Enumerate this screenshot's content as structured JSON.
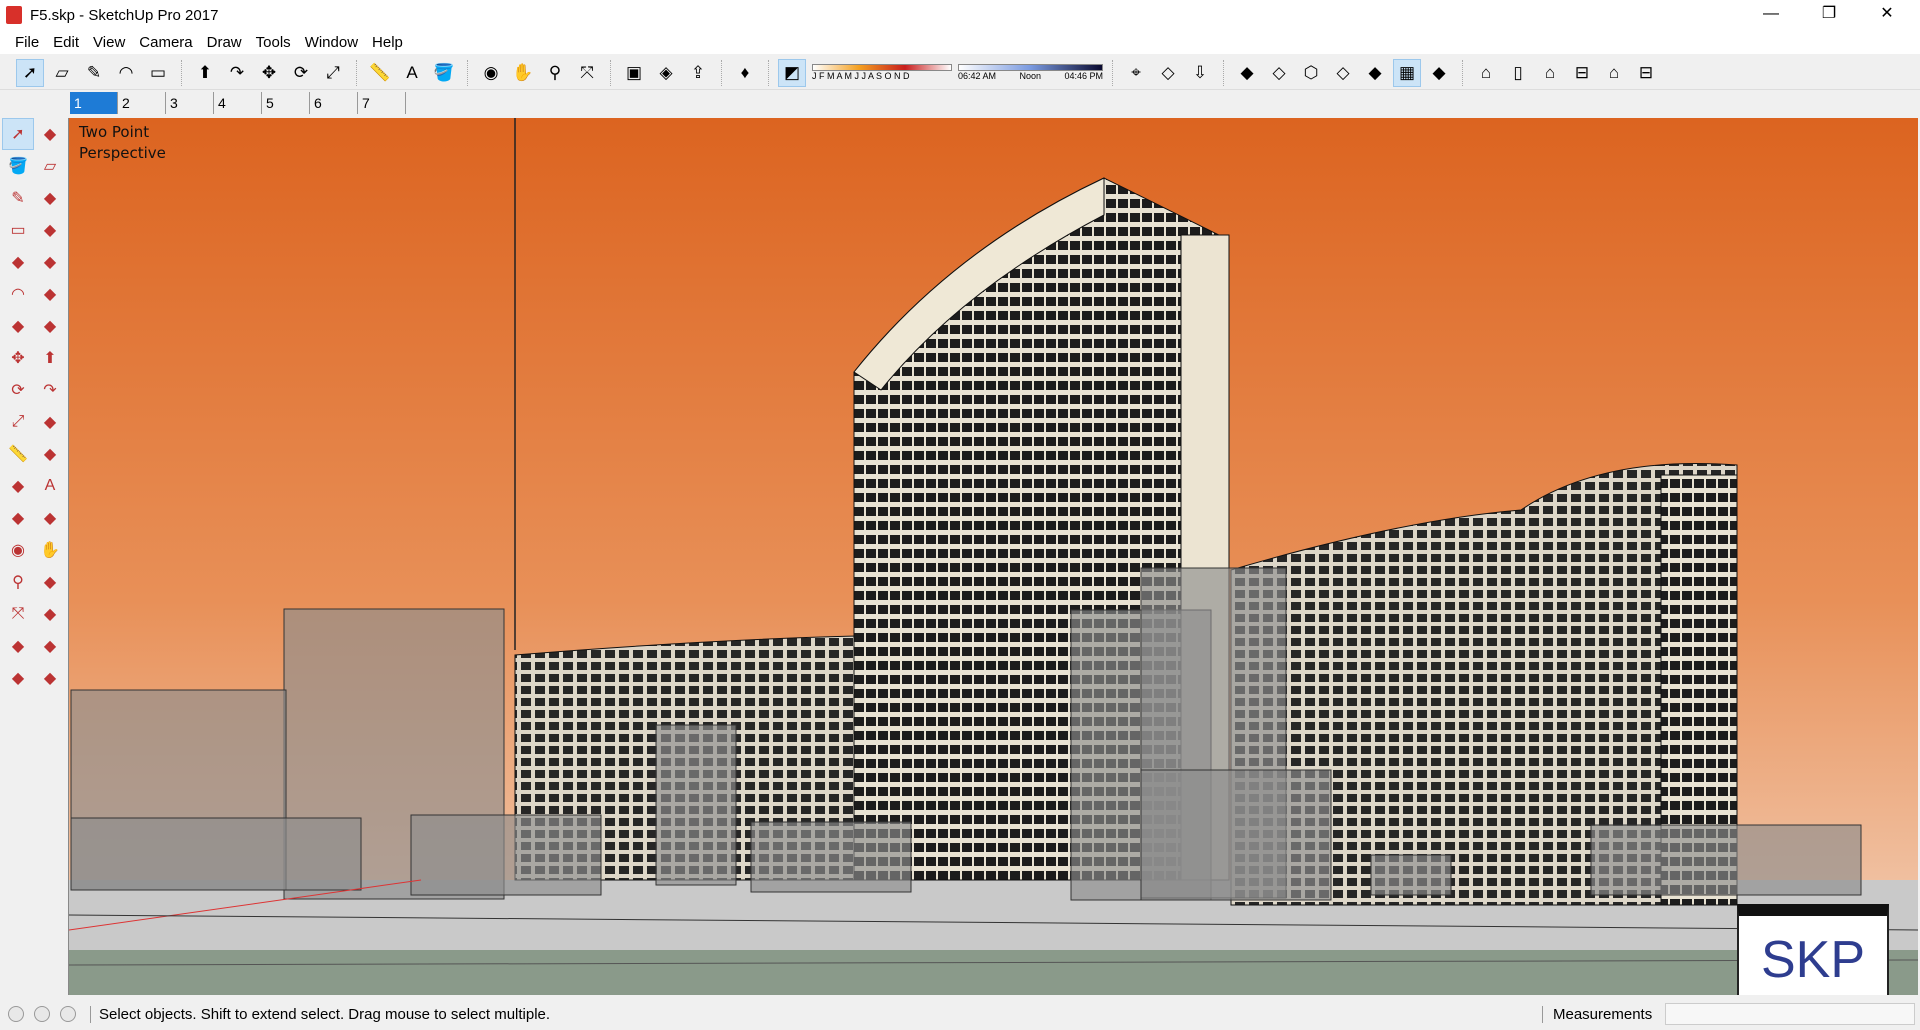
{
  "window": {
    "title": "F5.skp - SketchUp Pro 2017",
    "minimize": "—",
    "restore": "❐",
    "close": "✕"
  },
  "menu": [
    "File",
    "Edit",
    "View",
    "Camera",
    "Draw",
    "Tools",
    "Window",
    "Help"
  ],
  "toolbar": {
    "icons_a": [
      "select-icon",
      "eraser-icon",
      "pencil-icon",
      "arc-icon",
      "rectangle-icon"
    ],
    "icons_b": [
      "push-pull-icon",
      "follow-me-icon",
      "move-icon",
      "rotate-icon",
      "scale-icon"
    ],
    "icons_c": [
      "tape-measure-icon",
      "text-icon",
      "paint-bucket-icon"
    ],
    "icons_d": [
      "orbit-icon",
      "pan-icon",
      "zoom-icon",
      "zoom-extents-icon"
    ],
    "icons_e": [
      "warehouse-icon",
      "extension-icon",
      "share-model-icon"
    ],
    "icons_f": [
      "ruby-icon"
    ],
    "shadow": {
      "months": "J F M A M J J A S O N D",
      "time_start": "06:42 AM",
      "time_mid": "Noon",
      "time_end": "04:46 PM"
    },
    "icons_g": [
      "geo-location-icon",
      "terrain-icon",
      "add-location-icon"
    ],
    "icons_h": [
      "xray-icon",
      "back-edges-icon",
      "wireframe-icon",
      "hidden-line-icon",
      "shaded-icon",
      "shaded-textures-icon",
      "monochrome-icon"
    ],
    "icons_i": [
      "iso-view-icon",
      "top-view-icon",
      "front-view-icon",
      "right-view-icon",
      "back-view-icon",
      "left-view-icon"
    ]
  },
  "tabs": [
    "1",
    "2",
    "3",
    "4",
    "5",
    "6",
    "7"
  ],
  "left_tools": [
    "select-icon",
    "component-icon",
    "paint-bucket-icon",
    "eraser-icon",
    "pencil-icon",
    "freehand-icon",
    "rectangle-icon",
    "rotated-rectangle-icon",
    "circle-icon",
    "polygon-icon",
    "arc-icon",
    "pie-icon",
    "three-point-arc-icon",
    "two-point-arc-icon",
    "move-icon",
    "push-pull-icon",
    "rotate-icon",
    "follow-me-icon",
    "scale-icon",
    "offset-icon",
    "tape-measure-icon",
    "dimension-icon",
    "protractor-icon",
    "text-icon",
    "axes-icon",
    "3d-text-icon",
    "orbit-icon",
    "pan-icon",
    "zoom-icon",
    "zoom-window-icon",
    "zoom-extents-icon",
    "previous-view-icon",
    "position-camera-icon",
    "look-around-icon",
    "walk-icon",
    "section-plane-icon"
  ],
  "viewport": {
    "camera_label_1": "Two Point",
    "camera_label_2": "Perspective",
    "logo": "SKP"
  },
  "status": {
    "text": "Select objects. Shift to extend select. Drag mouse to select multiple.",
    "measurements_label": "Measurements",
    "measurements_value": ""
  }
}
